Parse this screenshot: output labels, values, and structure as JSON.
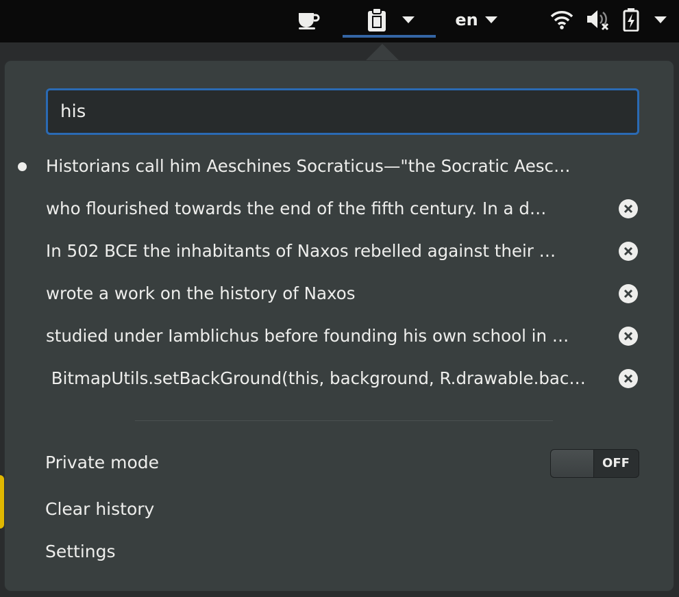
{
  "topbar": {
    "coffee_icon": "coffee-cup-icon",
    "clipboard_icon": "clipboard-icon",
    "language": "en",
    "wifi_icon": "wifi-icon",
    "volume_icon": "volume-muted-icon",
    "battery_icon": "battery-charging-icon",
    "accent_color": "#3465a4"
  },
  "search": {
    "value": "his"
  },
  "history": [
    {
      "text": "Historians call him Aeschines Socraticus—\"the Socratic Aesc…",
      "active": true
    },
    {
      "text": "who flourished towards the end of the fifth century. In a d…",
      "active": false
    },
    {
      "text": "In 502 BCE the inhabitants of Naxos rebelled against their …",
      "active": false
    },
    {
      "text": "wrote a work on the history of Naxos",
      "active": false
    },
    {
      "text": "studied under Iamblichus before founding his own school in …",
      "active": false
    },
    {
      "text": " BitmapUtils.setBackGround(this, background, R.drawable.bac…",
      "active": false
    }
  ],
  "private_mode": {
    "label": "Private mode",
    "state": "OFF"
  },
  "actions": {
    "clear_history": "Clear history",
    "settings": "Settings"
  }
}
